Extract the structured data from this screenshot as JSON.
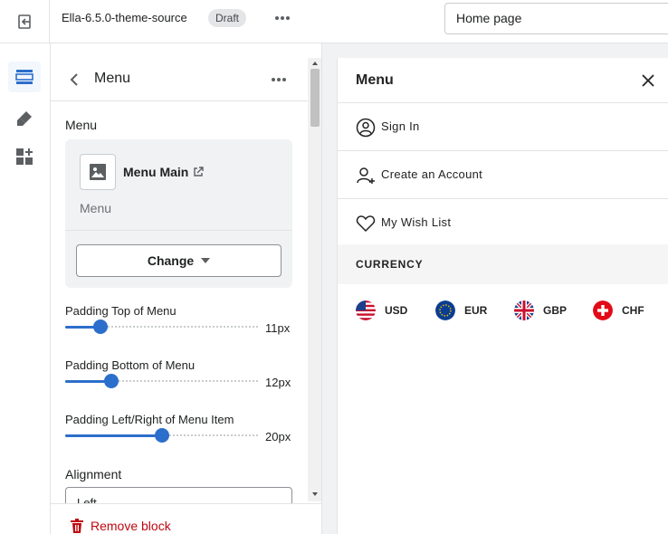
{
  "topbar": {
    "theme_name": "Ella-6.5.0-theme-source",
    "status_badge": "Draft",
    "page_select": "Home page"
  },
  "panel": {
    "title": "Menu",
    "section_label": "Menu",
    "menu_card": {
      "name": "Menu Main",
      "subtitle": "Menu",
      "change_label": "Change"
    },
    "sliders": [
      {
        "label": "Padding Top of Menu",
        "value": 11,
        "display": "11px",
        "min": 0,
        "max": 60
      },
      {
        "label": "Padding Bottom of Menu",
        "value": 12,
        "display": "12px",
        "min": 0,
        "max": 50
      },
      {
        "label": "Padding Left/Right of Menu Item",
        "value": 20,
        "display": "20px",
        "min": 0,
        "max": 40
      }
    ],
    "alignment_label": "Alignment",
    "alignment_value": "Left",
    "remove_label": "Remove block"
  },
  "preview": {
    "title": "Menu",
    "rows": [
      {
        "label": "Sign In",
        "icon": "user-circle-icon"
      },
      {
        "label": "Create an Account",
        "icon": "user-plus-icon"
      },
      {
        "label": "My Wish List",
        "icon": "heart-icon"
      }
    ],
    "currency_heading": "CURRENCY",
    "currencies": [
      {
        "code": "USD",
        "icon": "us-flag-icon"
      },
      {
        "code": "EUR",
        "icon": "eu-flag-icon"
      },
      {
        "code": "GBP",
        "icon": "uk-flag-icon"
      },
      {
        "code": "CHF",
        "icon": "swiss-flag-icon"
      }
    ]
  },
  "colors": {
    "accent": "#2c6ecb",
    "danger": "#bf0711"
  }
}
